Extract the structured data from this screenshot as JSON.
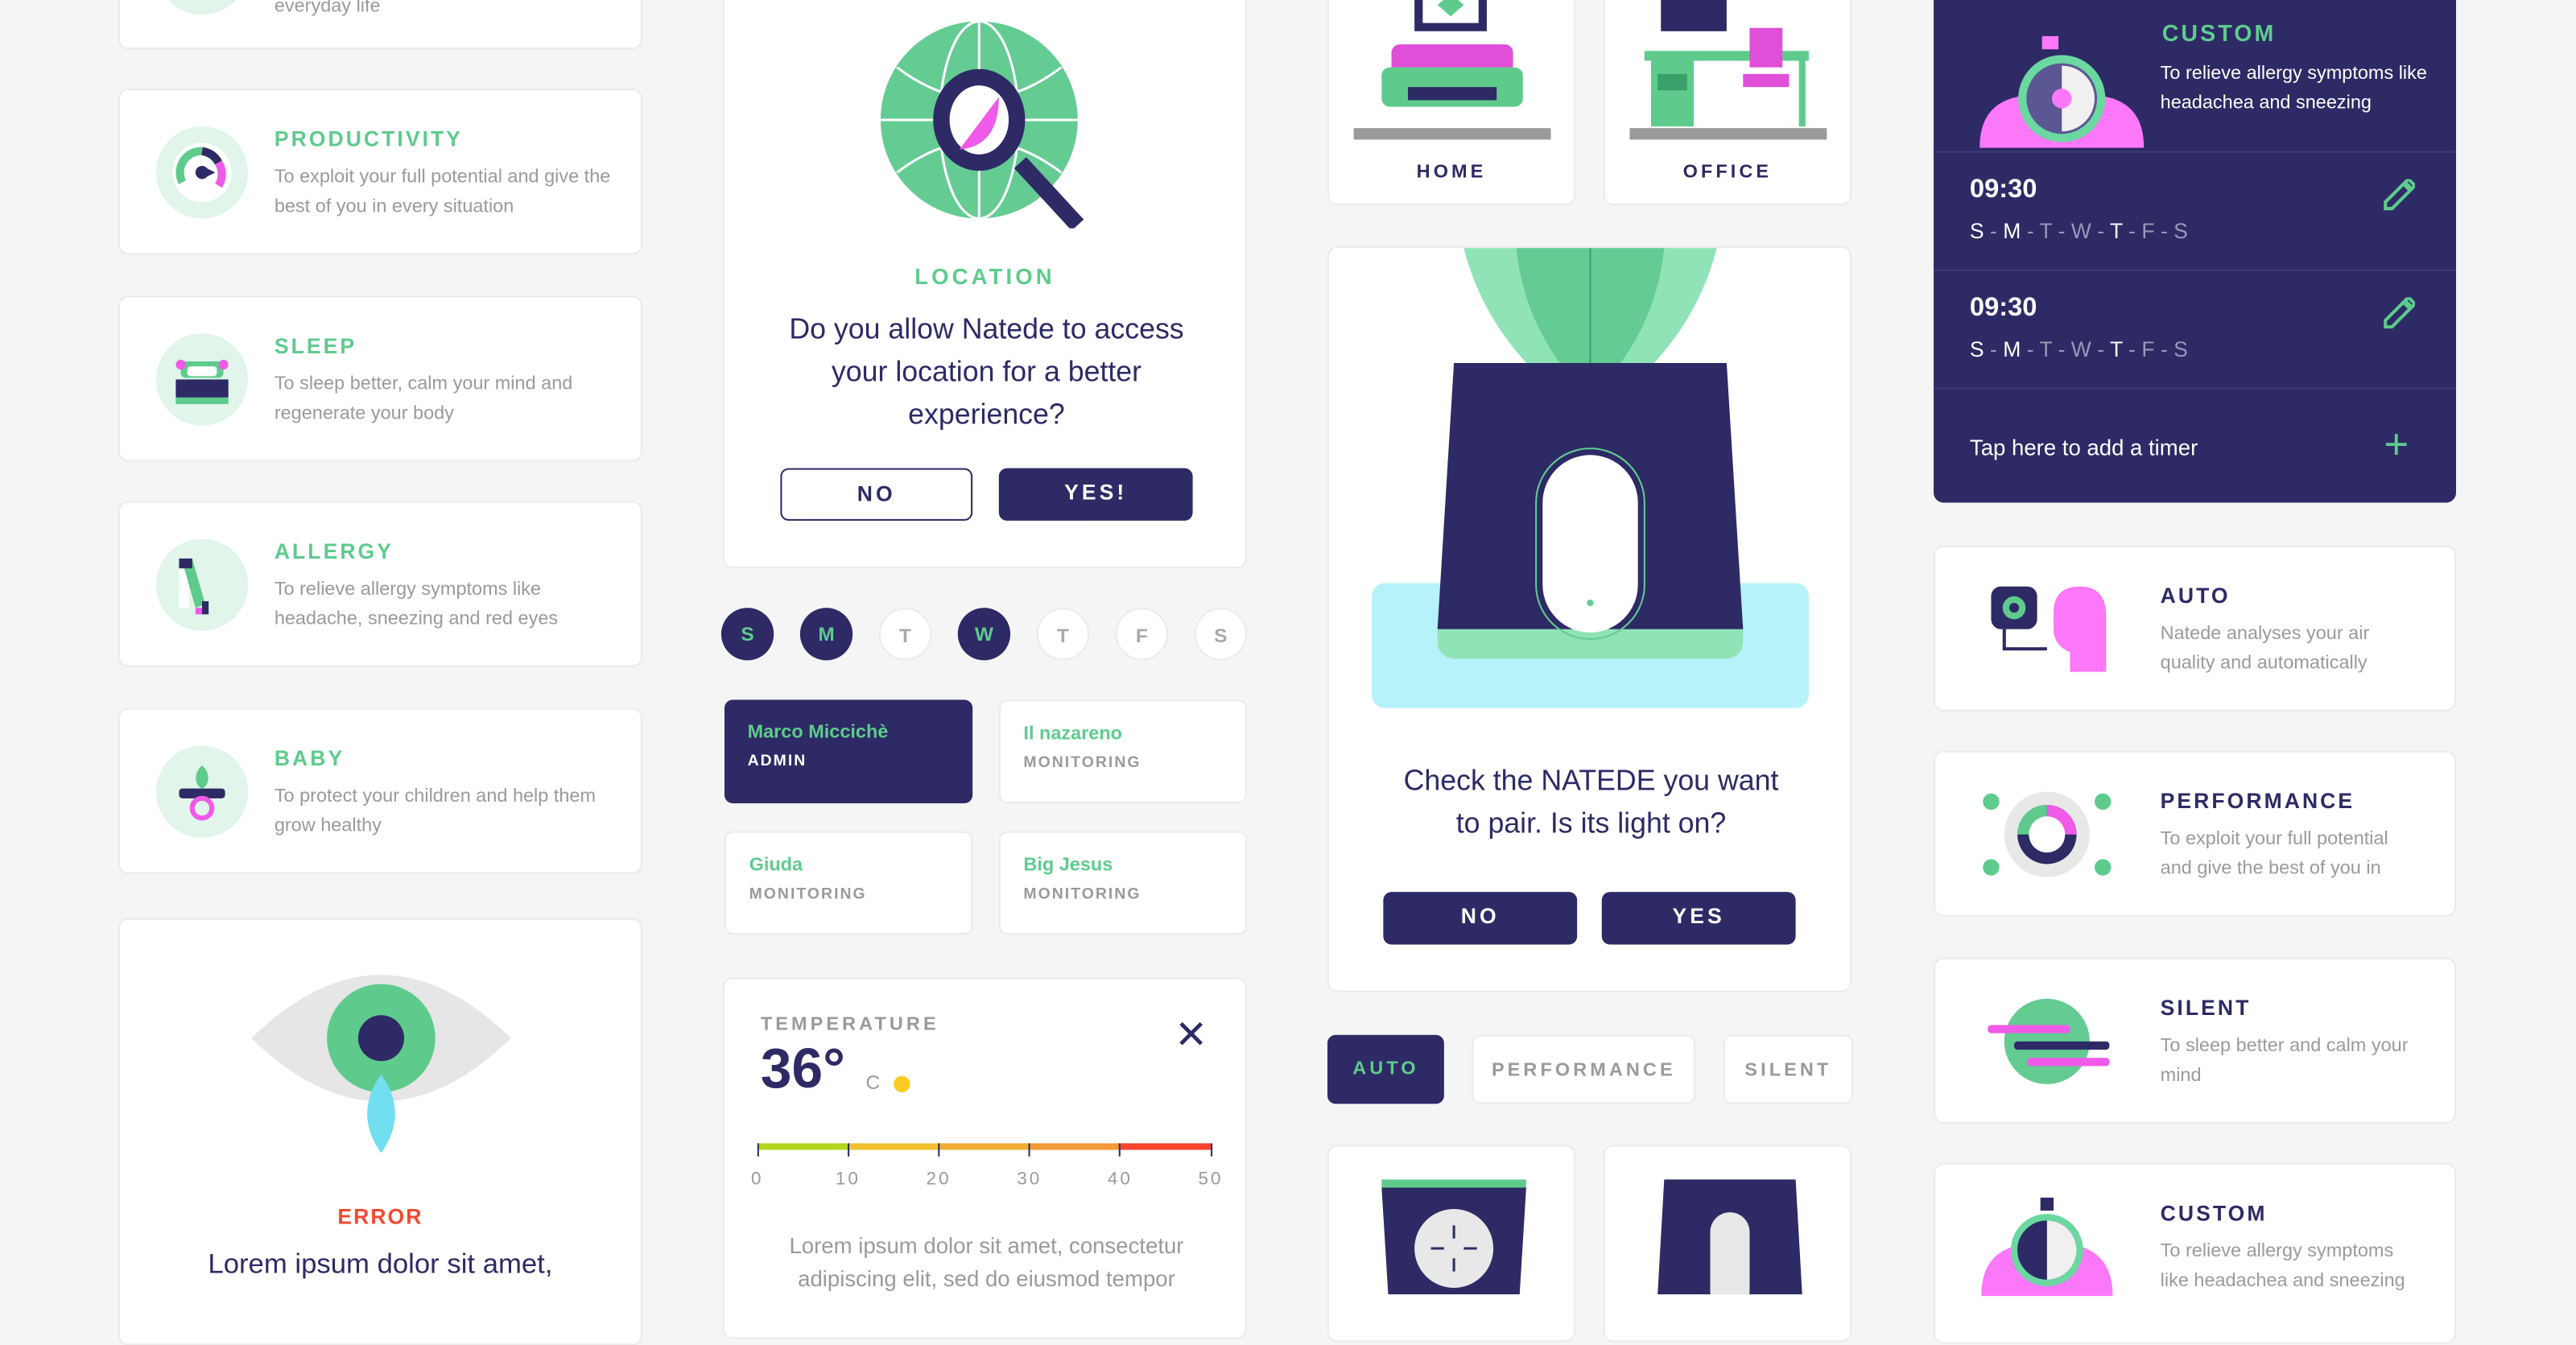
{
  "features": [
    {
      "title": "",
      "desc": "everyday life"
    },
    {
      "title": "PRODUCTIVITY",
      "desc": "To exploit your full potential and give the best of you in every situation"
    },
    {
      "title": "SLEEP",
      "desc": "To sleep better, calm your mind and regenerate your body"
    },
    {
      "title": "ALLERGY",
      "desc": "To relieve allergy symptoms like headache, sneezing and red eyes"
    },
    {
      "title": "BABY",
      "desc": "To protect your children and help them grow healthy"
    }
  ],
  "error": {
    "label": "ERROR",
    "text": "Lorem ipsum dolor sit amet,"
  },
  "location": {
    "label": "LOCATION",
    "question": "Do you allow Natede to access your location for a better experience?",
    "no": "NO",
    "yes": "YES!"
  },
  "week": [
    {
      "d": "S",
      "on": true
    },
    {
      "d": "M",
      "on": true
    },
    {
      "d": "T",
      "on": false
    },
    {
      "d": "W",
      "on": true
    },
    {
      "d": "T",
      "on": false
    },
    {
      "d": "F",
      "on": false
    },
    {
      "d": "S",
      "on": false
    }
  ],
  "users": [
    {
      "name": "Marco Miccichè",
      "role": "ADMIN"
    },
    {
      "name": "Il nazareno",
      "role": "MONITORING"
    },
    {
      "name": "Giuda",
      "role": "MONITORING"
    },
    {
      "name": "Big Jesus",
      "role": "MONITORING"
    }
  ],
  "temperature": {
    "label": "TEMPERATURE",
    "value": "36°",
    "unit": "C",
    "ticks": [
      "0",
      "10",
      "20",
      "30",
      "40",
      "50"
    ],
    "text": "Lorem ipsum dolor sit amet, consectetur adipiscing elit, sed do eiusmod tempor",
    "colors": [
      "#b2d61d",
      "#f2c12e",
      "#f2ae32",
      "#f39b35",
      "#f5452b"
    ],
    "indicator_color": "#fbcd22"
  },
  "rooms": [
    {
      "label": "HOME"
    },
    {
      "label": "OFFICE"
    }
  ],
  "pair": {
    "question": "Check the NATEDE you want to pair. Is its light on?",
    "no": "NO",
    "yes": "YES"
  },
  "modes": {
    "items": [
      "AUTO",
      "PERFORMANCE",
      "SILENT"
    ],
    "active": "AUTO"
  },
  "custom_timer": {
    "title": "CUSTOM",
    "desc": "To relieve allergy symptoms like headachea and sneezing",
    "timers": [
      {
        "time": "09:30",
        "days": [
          [
            "S",
            true
          ],
          [
            "M",
            true
          ],
          [
            "T",
            false
          ],
          [
            "W",
            false
          ],
          [
            "T",
            true
          ],
          [
            "F",
            false
          ],
          [
            "S",
            false
          ]
        ]
      },
      {
        "time": "09:30",
        "days": [
          [
            "S",
            true
          ],
          [
            "M",
            true
          ],
          [
            "T",
            false
          ],
          [
            "W",
            false
          ],
          [
            "T",
            true
          ],
          [
            "F",
            false
          ],
          [
            "S",
            false
          ]
        ]
      }
    ],
    "add": "Tap here to add a timer"
  },
  "mode_cards": [
    {
      "title": "AUTO",
      "desc": "Natede analyses your air quality and automatically"
    },
    {
      "title": "PERFORMANCE",
      "desc": "To exploit your full potential and give the best of you in"
    },
    {
      "title": "SILENT",
      "desc": "To sleep better and calm your mind"
    },
    {
      "title": "CUSTOM",
      "desc": "To relieve allergy symptoms like headachea and sneezing"
    }
  ],
  "colors": {
    "navy": "#2d2a65",
    "green": "#5ecb8d",
    "pink": "#f05ae8",
    "bg": "#f5f5f5"
  }
}
